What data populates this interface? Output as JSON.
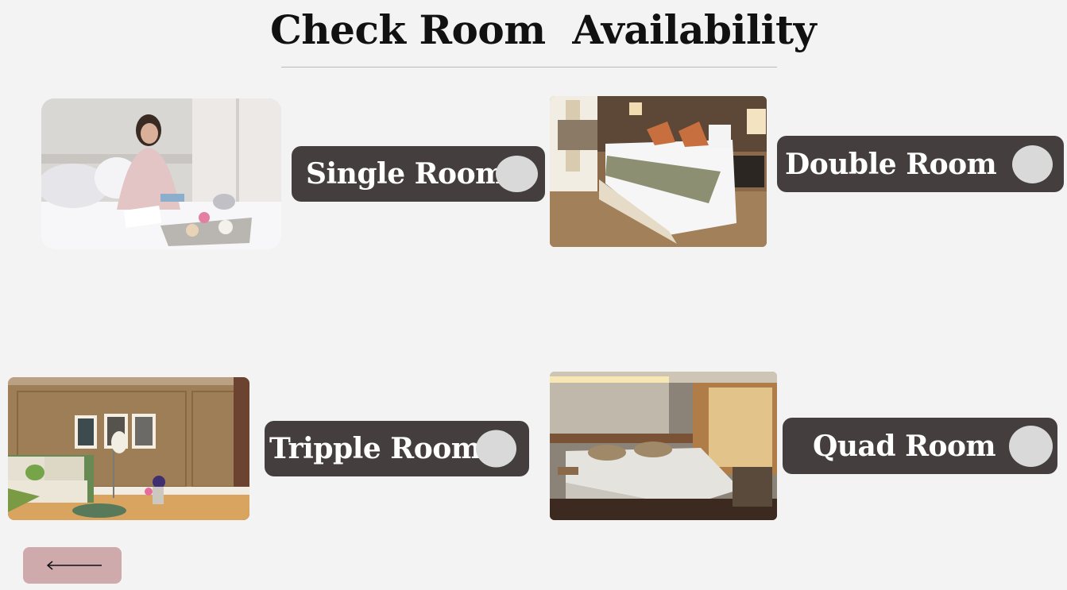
{
  "page": {
    "title": "Check Room  Availability",
    "colors": {
      "background": "#f3f3f3",
      "pill": "#443f3e",
      "toggle": "#d9d9d9",
      "back_button": "#cfaaad"
    }
  },
  "rooms": [
    {
      "label": "Single Room",
      "image": "woman-on-bed-photo",
      "toggle": "off"
    },
    {
      "label": "Double Room",
      "image": "double-bed-hotel-photo",
      "toggle": "off"
    },
    {
      "label": "Tripple Room",
      "image": "bedroom-with-frames-photo",
      "toggle": "off"
    },
    {
      "label": "Quad Room",
      "image": "twin-beds-hotel-photo",
      "toggle": "off"
    }
  ],
  "back_button": {
    "icon": "arrow-left-icon"
  }
}
